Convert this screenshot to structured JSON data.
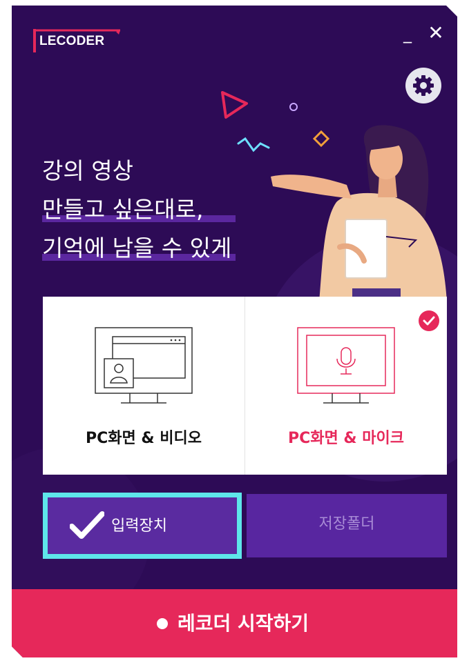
{
  "app": {
    "logo_text": "LECODER"
  },
  "window_controls": {
    "minimize": "_",
    "close": "✕"
  },
  "icons": {
    "settings": "gear-icon",
    "check_badge": "check-circle-icon",
    "input_check": "checkmark-icon",
    "start_dot": "record-dot-icon"
  },
  "headline": {
    "line1": "강의 영상",
    "line2": "만들고 싶은대로,",
    "line3": "기억에 남을 수 있게"
  },
  "modes": [
    {
      "label": "PC화면 & 비디오",
      "selected": false
    },
    {
      "label": "PC화면 & 마이크",
      "selected": true
    }
  ],
  "buttons": {
    "input_device": "입력장치",
    "save_folder": "저장폴더",
    "start": "레코더 시작하기"
  },
  "colors": {
    "background": "#2d0b56",
    "accent": "#e6285a",
    "highlight_border": "#5ee6ea",
    "button_purple": "#5826a0",
    "inactive_text": "#a98cd6"
  }
}
